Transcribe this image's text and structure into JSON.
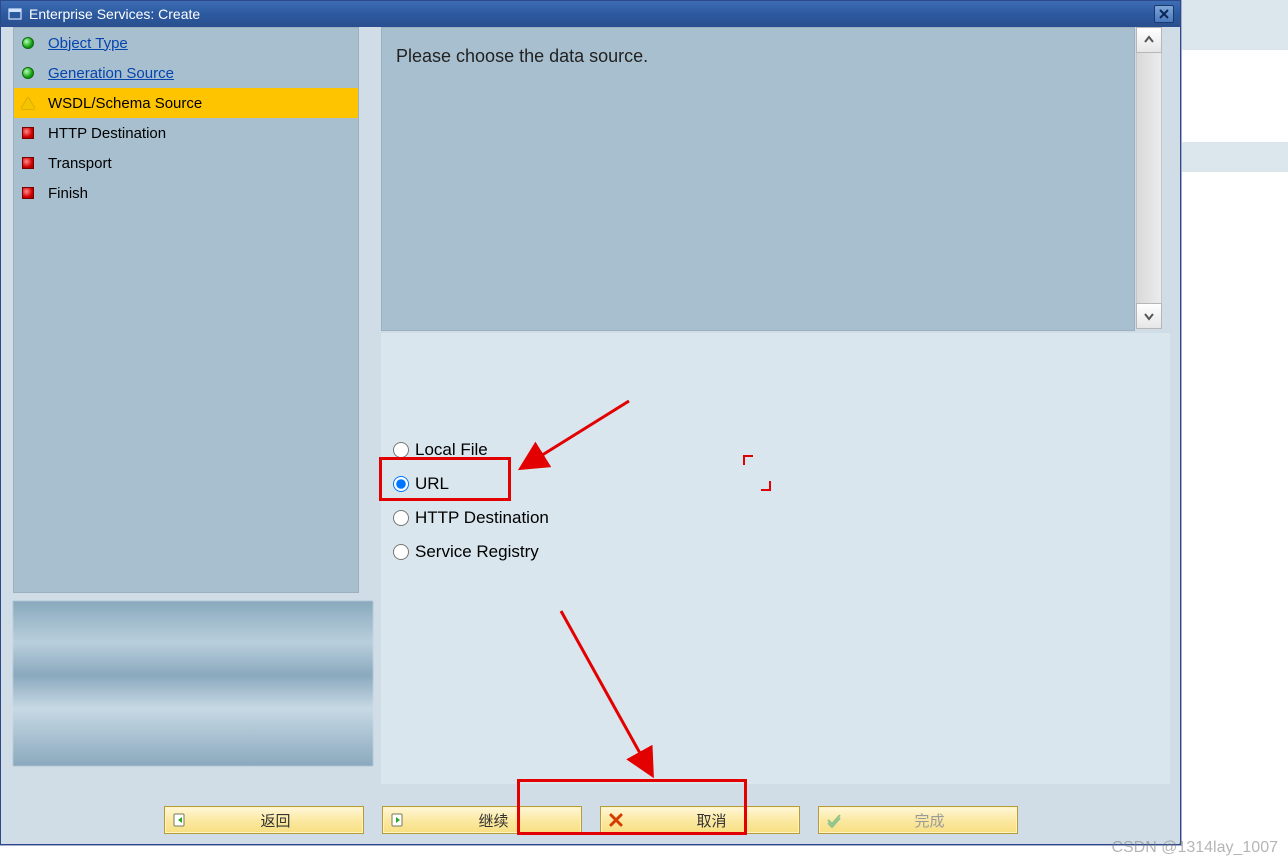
{
  "window": {
    "title": "Enterprise Services: Create"
  },
  "sidebar": {
    "items": [
      {
        "label": "Object Type",
        "state": "done",
        "link": true
      },
      {
        "label": "Generation Source",
        "state": "done",
        "link": true
      },
      {
        "label": "WSDL/Schema Source",
        "state": "warn",
        "link": false,
        "selected": true
      },
      {
        "label": "HTTP Destination",
        "state": "pending",
        "link": false
      },
      {
        "label": "Transport",
        "state": "pending",
        "link": false
      },
      {
        "label": "Finish",
        "state": "pending",
        "link": false
      }
    ]
  },
  "description": {
    "text": "Please choose the data source."
  },
  "radios": {
    "items": [
      {
        "label": "Local File",
        "selected": false
      },
      {
        "label": "URL",
        "selected": true
      },
      {
        "label": "HTTP Destination",
        "selected": false
      },
      {
        "label": "Service Registry",
        "selected": false
      }
    ]
  },
  "buttons": {
    "back": "返回",
    "continue": "继续",
    "cancel": "取消",
    "finish": "完成"
  },
  "watermark": "CSDN @1314lay_1007"
}
